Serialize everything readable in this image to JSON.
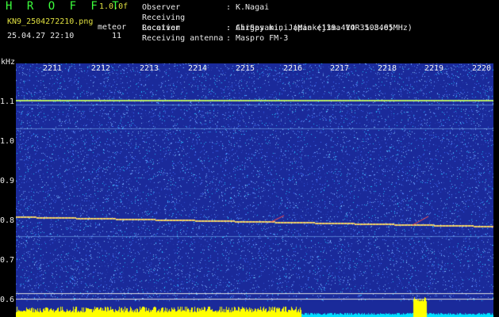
{
  "header": {
    "app_title": "H R O F F T",
    "version": "1.0.0f",
    "filename": "KN9_2504272210.png",
    "meteor_label": "meteor",
    "datetime": "25.04.27 22:10",
    "count": "11"
  },
  "info": [
    {
      "key": "Observer",
      "value": "K.Nagai"
    },
    {
      "key": "Receiving Location",
      "value": "Chigasaki, Japan (139.414 35.340)"
    },
    {
      "key": "Receiver",
      "value": "AirSpy mini (Miakejima VOR 108.65MHz)"
    },
    {
      "key": "Receiving antenna",
      "value": "Maspro FM-3"
    }
  ],
  "axis": {
    "unit": "kHz",
    "y_ticks": [
      "1.1",
      "1.0",
      "0.9",
      "0.8",
      "0.7",
      "0.6"
    ],
    "time_ticks": [
      "2211",
      "2212",
      "2213",
      "2214",
      "2215",
      "2216",
      "2217",
      "2218",
      "2219",
      "2220"
    ]
  },
  "colors": {
    "background": "#1a2a9a",
    "noise_dot": "#5a8cff",
    "signal_line": "#f0e070",
    "meteor": "#ff5050",
    "power_bar": "#ffff00",
    "power_low": "#00e0ff"
  }
}
